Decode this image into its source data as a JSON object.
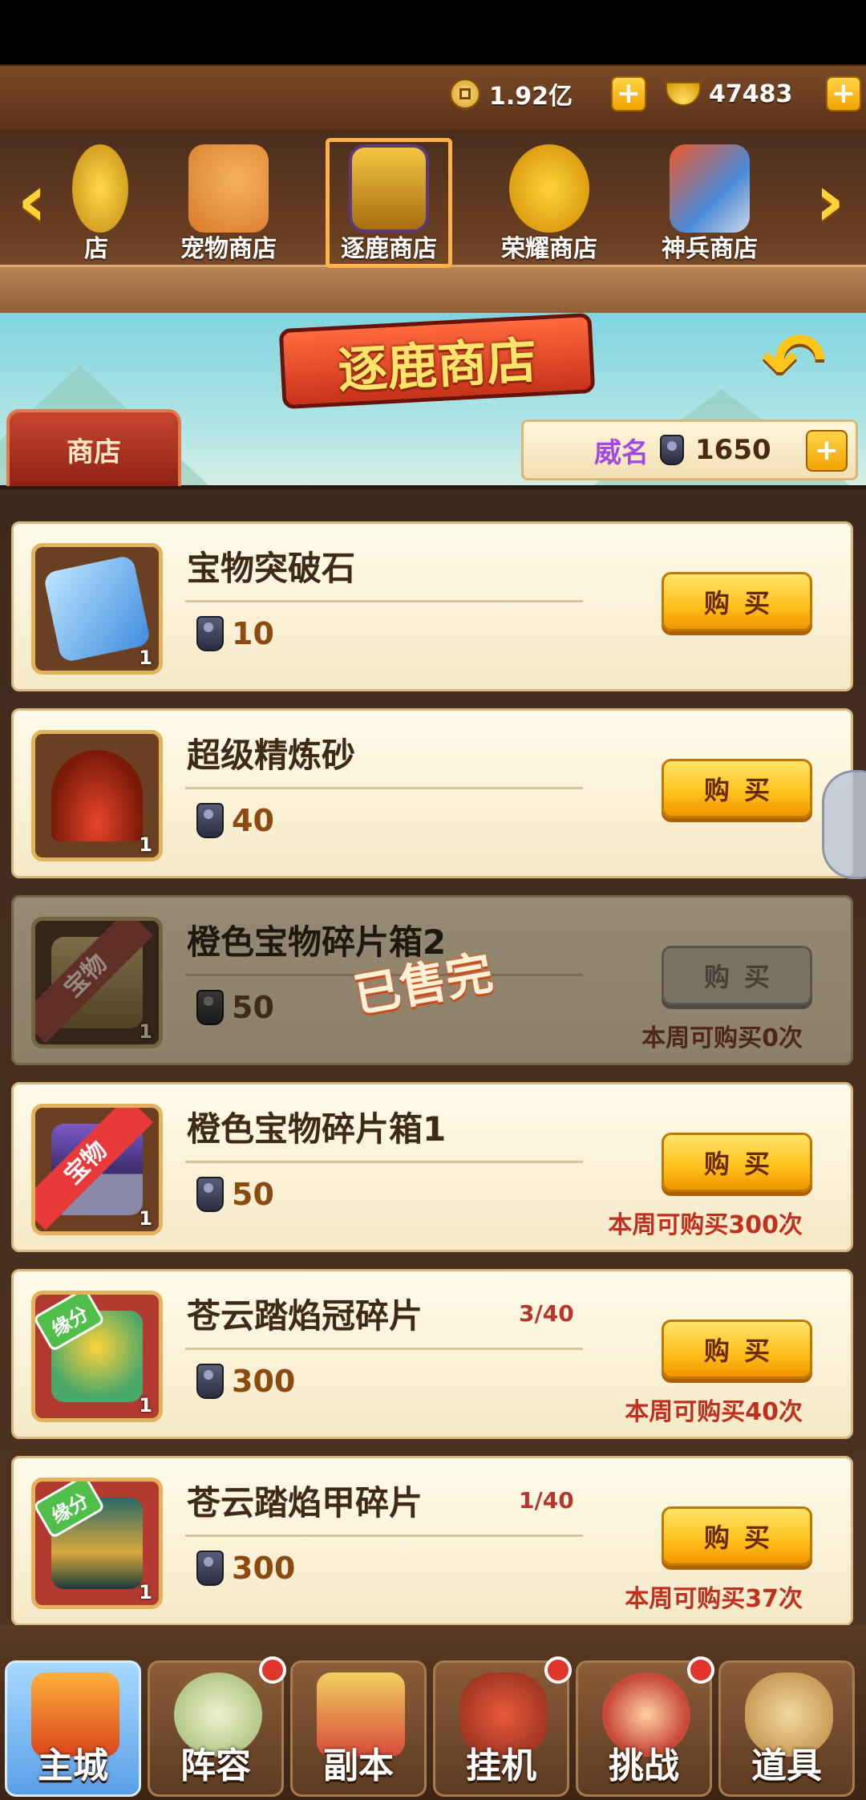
{
  "resources": {
    "coins": "1.92亿",
    "ingots": "47483"
  },
  "shop_tabs": [
    {
      "label": "店",
      "icon": "coin-shop-icon"
    },
    {
      "label": "宠物商店",
      "icon": "corgi-pet-icon"
    },
    {
      "label": "逐鹿商店",
      "icon": "treasure-chest-icon",
      "selected": true
    },
    {
      "label": "荣耀商店",
      "icon": "gold-medal-scroll-icon"
    },
    {
      "label": "神兵商店",
      "icon": "sword-icon"
    }
  ],
  "banner_title": "逐鹿商店",
  "shop_tab_label": "商店",
  "fame": {
    "label": "威名",
    "value": "1650"
  },
  "buy_label": "购买",
  "sold_out_text": "已售完",
  "items": [
    {
      "name": "宝物突破石",
      "price": "10",
      "qty": "1",
      "icon": "blue-rune-stone-icon"
    },
    {
      "name": "超级精炼砂",
      "price": "40",
      "qty": "1",
      "icon": "red-sand-pile-icon"
    },
    {
      "name": "橙色宝物碎片箱2",
      "price": "50",
      "qty": "1",
      "icon": "treasure-box-icon",
      "ribbon": "宝物",
      "limit": "本周可购买0次",
      "sold_out": true
    },
    {
      "name": "橙色宝物碎片箱1",
      "price": "50",
      "qty": "1",
      "icon": "purple-treasure-chest-icon",
      "ribbon": "宝物",
      "limit": "本周可购买300次"
    },
    {
      "name": "苍云踏焰冠碎片",
      "price": "300",
      "qty": "1",
      "progress": "3/40",
      "icon": "golden-crown-icon",
      "tag": "缘分",
      "limit": "本周可购买40次"
    },
    {
      "name": "苍云踏焰甲碎片",
      "price": "300",
      "qty": "1",
      "progress": "1/40",
      "icon": "armor-icon",
      "tag": "缘分",
      "limit": "本周可购买37次"
    }
  ],
  "bottom_nav": [
    {
      "label": "主城",
      "icon": "palace-icon",
      "active": true
    },
    {
      "label": "阵容",
      "icon": "formation-icon",
      "badge": true
    },
    {
      "label": "副本",
      "icon": "dungeon-icon"
    },
    {
      "label": "挂机",
      "icon": "idle-bag-icon",
      "badge": true
    },
    {
      "label": "挑战",
      "icon": "challenge-icon",
      "badge": true
    },
    {
      "label": "道具",
      "icon": "item-pot-icon"
    }
  ]
}
